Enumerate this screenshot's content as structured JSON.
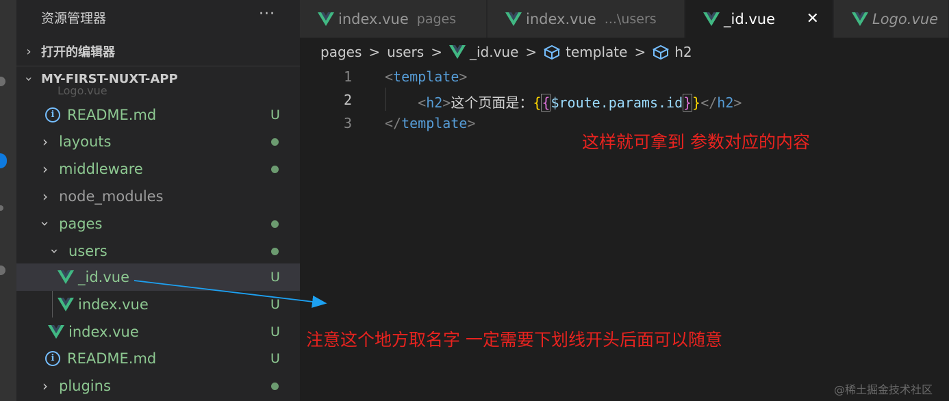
{
  "sidebar": {
    "title": "资源管理器",
    "more": "···",
    "open_editors": "打开的编辑器",
    "project": "MY-FIRST-NUXT-APP",
    "ghost_item": "Logo.vue",
    "items": [
      {
        "label": "README.md",
        "status": "U"
      },
      {
        "label": "layouts"
      },
      {
        "label": "middleware"
      },
      {
        "label": "node_modules"
      },
      {
        "label": "pages"
      },
      {
        "label": "users"
      },
      {
        "label": "_id.vue",
        "status": "U"
      },
      {
        "label": "index.vue",
        "status": "U"
      },
      {
        "label": "index.vue",
        "status": "U"
      },
      {
        "label": "README.md",
        "status": "U"
      },
      {
        "label": "plugins"
      }
    ]
  },
  "tabs": [
    {
      "label": "index.vue",
      "desc": "pages"
    },
    {
      "label": "index.vue",
      "desc": "...\\users"
    },
    {
      "label": "_id.vue",
      "close": "✕"
    },
    {
      "label": "Logo.vue"
    }
  ],
  "breadcrumb": {
    "items": [
      "pages",
      "users",
      "_id.vue",
      "template",
      "h2"
    ],
    "sep": ">"
  },
  "editor": {
    "line_numbers": [
      "1",
      "2",
      "3"
    ],
    "line1_tag": "template",
    "line2_tag_open": "h2",
    "line2_text": "这个页面是：",
    "line2_var": "$route.params.id",
    "line2_tag_close": "h2",
    "line3_tag": "template"
  },
  "annotations": {
    "code_note": "这样就可拿到  参数对应的内容",
    "file_note": "注意这个地方取名字  一定需要下划线开头后面可以随意"
  },
  "watermark": "@稀土掘金技术社区",
  "colors": {
    "annotation_red": "#e8231f",
    "arrow_blue": "#1da1f2",
    "vue_green": "#41b883",
    "git_untracked": "#8dc891"
  }
}
